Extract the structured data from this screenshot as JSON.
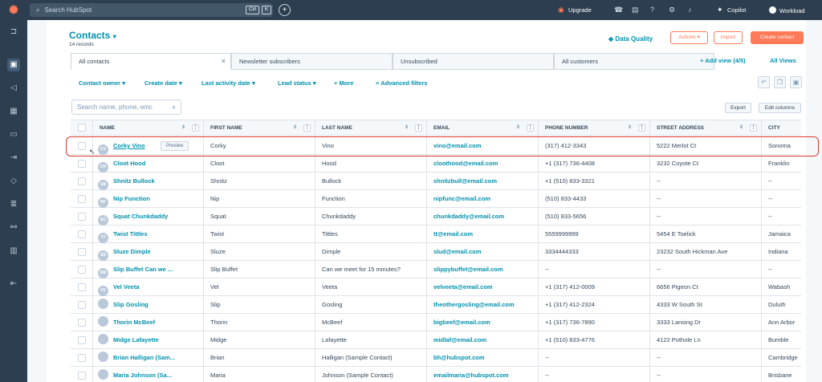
{
  "topbar": {
    "search_placeholder": "Search HubSpot",
    "kbd_ctrl": "Ctrl",
    "kbd_k": "K",
    "upgrade": "Upgrade",
    "copilot": "Copilot",
    "workload": "Workload"
  },
  "header": {
    "title": "Contacts",
    "records": "14 records",
    "data_quality": "Data Quality",
    "actions": "Actions",
    "import": "Import",
    "create": "Create contact"
  },
  "tabs": [
    {
      "label": "All contacts"
    },
    {
      "label": "Newsletter subscribers"
    },
    {
      "label": "Unsubscribed"
    },
    {
      "label": "All customers"
    }
  ],
  "add_view": "Add view (4/5)",
  "all_views": "All Views",
  "filters": {
    "owner": "Contact owner",
    "create_date": "Create date",
    "last_activity": "Last activity date",
    "lead_status": "Lead status",
    "more": "More",
    "advanced": "Advanced filters"
  },
  "search_placeholder": "Search name, phone, emc",
  "export": "Export",
  "edit_columns": "Edit columns",
  "preview": "Preview",
  "columns": [
    "NAME",
    "FIRST NAME",
    "LAST NAME",
    "EMAIL",
    "PHONE NUMBER",
    "STREET ADDRESS",
    "CITY"
  ],
  "rows": [
    {
      "initials": "CV",
      "name": "Corky Vino",
      "first": "Corky",
      "last": "Vino",
      "email": "vino@email.com",
      "phone": "(317) 412-3343",
      "street": "5222 Merlot Ct",
      "city": "Sonoma"
    },
    {
      "initials": "CH",
      "name": "Cloot Hood",
      "first": "Cloot",
      "last": "Hood",
      "email": "cloothood@email.com",
      "phone": "+1 (317) 736-4408",
      "street": "3232 Coyote Ct",
      "city": "Franklin"
    },
    {
      "initials": "SB",
      "name": "Shnitz Bullock",
      "first": "Shnitz",
      "last": "Bullock",
      "email": "shnitzbull@email.com",
      "phone": "+1 (510) 833-3321",
      "street": "--",
      "city": "--"
    },
    {
      "initials": "NF",
      "name": "Nip Function",
      "first": "Nip",
      "last": "Function",
      "email": "nipfunc@email.com",
      "phone": "(510) 833-4433",
      "street": "--",
      "city": "--"
    },
    {
      "initials": "SC",
      "name": "Squat Chunkdaddy",
      "first": "Squat",
      "last": "Chunkdaddy",
      "email": "chunkdaddy@email.com",
      "phone": "(510) 833-5656",
      "street": "--",
      "city": "--"
    },
    {
      "initials": "TT",
      "name": "Twist Tittles",
      "first": "Twist",
      "last": "Tittles",
      "email": "tt@email.com",
      "phone": "5559999999",
      "street": "5454 E Toelick",
      "city": "Jamaica"
    },
    {
      "initials": "SD",
      "name": "Sluze Dimple",
      "first": "Sluze",
      "last": "Dimple",
      "email": "slud@email.com",
      "phone": "3334444333",
      "street": "23232 South Hickman Ave",
      "city": "Indiana"
    },
    {
      "initials": "SW",
      "name": "Slip Buffet Can we ...",
      "first": "Slip Buffet",
      "last": "Can we meet for 15 minutes?",
      "email": "slippybuffet@email.com",
      "phone": "--",
      "street": "--",
      "city": "--"
    },
    {
      "initials": "VV",
      "name": "Vel Veeta",
      "first": "Vel",
      "last": "Veeta",
      "email": "velveeta@email.com",
      "phone": "+1 (317) 412-0009",
      "street": "6656 Pigeon Ct",
      "city": "Wabash"
    },
    {
      "initials": "",
      "name": "Slip Gosling",
      "first": "Slip",
      "last": "Gosling",
      "email": "theothergosling@email.com",
      "phone": "+1 (317) 412-2324",
      "street": "4333 W South St",
      "city": "Duluth"
    },
    {
      "initials": "",
      "name": "Thorin McBeef",
      "first": "Thorin",
      "last": "McBeef",
      "email": "bigbeef@email.com",
      "phone": "+1 (317) 736-7890",
      "street": "3333 Lansing Dr",
      "city": "Ann Arbor"
    },
    {
      "initials": "",
      "name": "Midge Lafayette",
      "first": "Midge",
      "last": "Lafayette",
      "email": "midlaf@email.com",
      "phone": "+1 (510) 833-4776",
      "street": "4122 Pothole Ln",
      "city": "Bumble"
    },
    {
      "initials": "",
      "name": "Brian Halligan (Sam...",
      "first": "Brian",
      "last": "Halligan (Sample Contact)",
      "email": "bh@hubspot.com",
      "phone": "--",
      "street": "--",
      "city": "Cambridge"
    },
    {
      "initials": "",
      "name": "Maria Johnson (Sa...",
      "first": "Maria",
      "last": "Johnson (Sample Contact)",
      "email": "emailmaria@hubspot.com",
      "phone": "--",
      "street": "--",
      "city": "Brisbane"
    }
  ]
}
